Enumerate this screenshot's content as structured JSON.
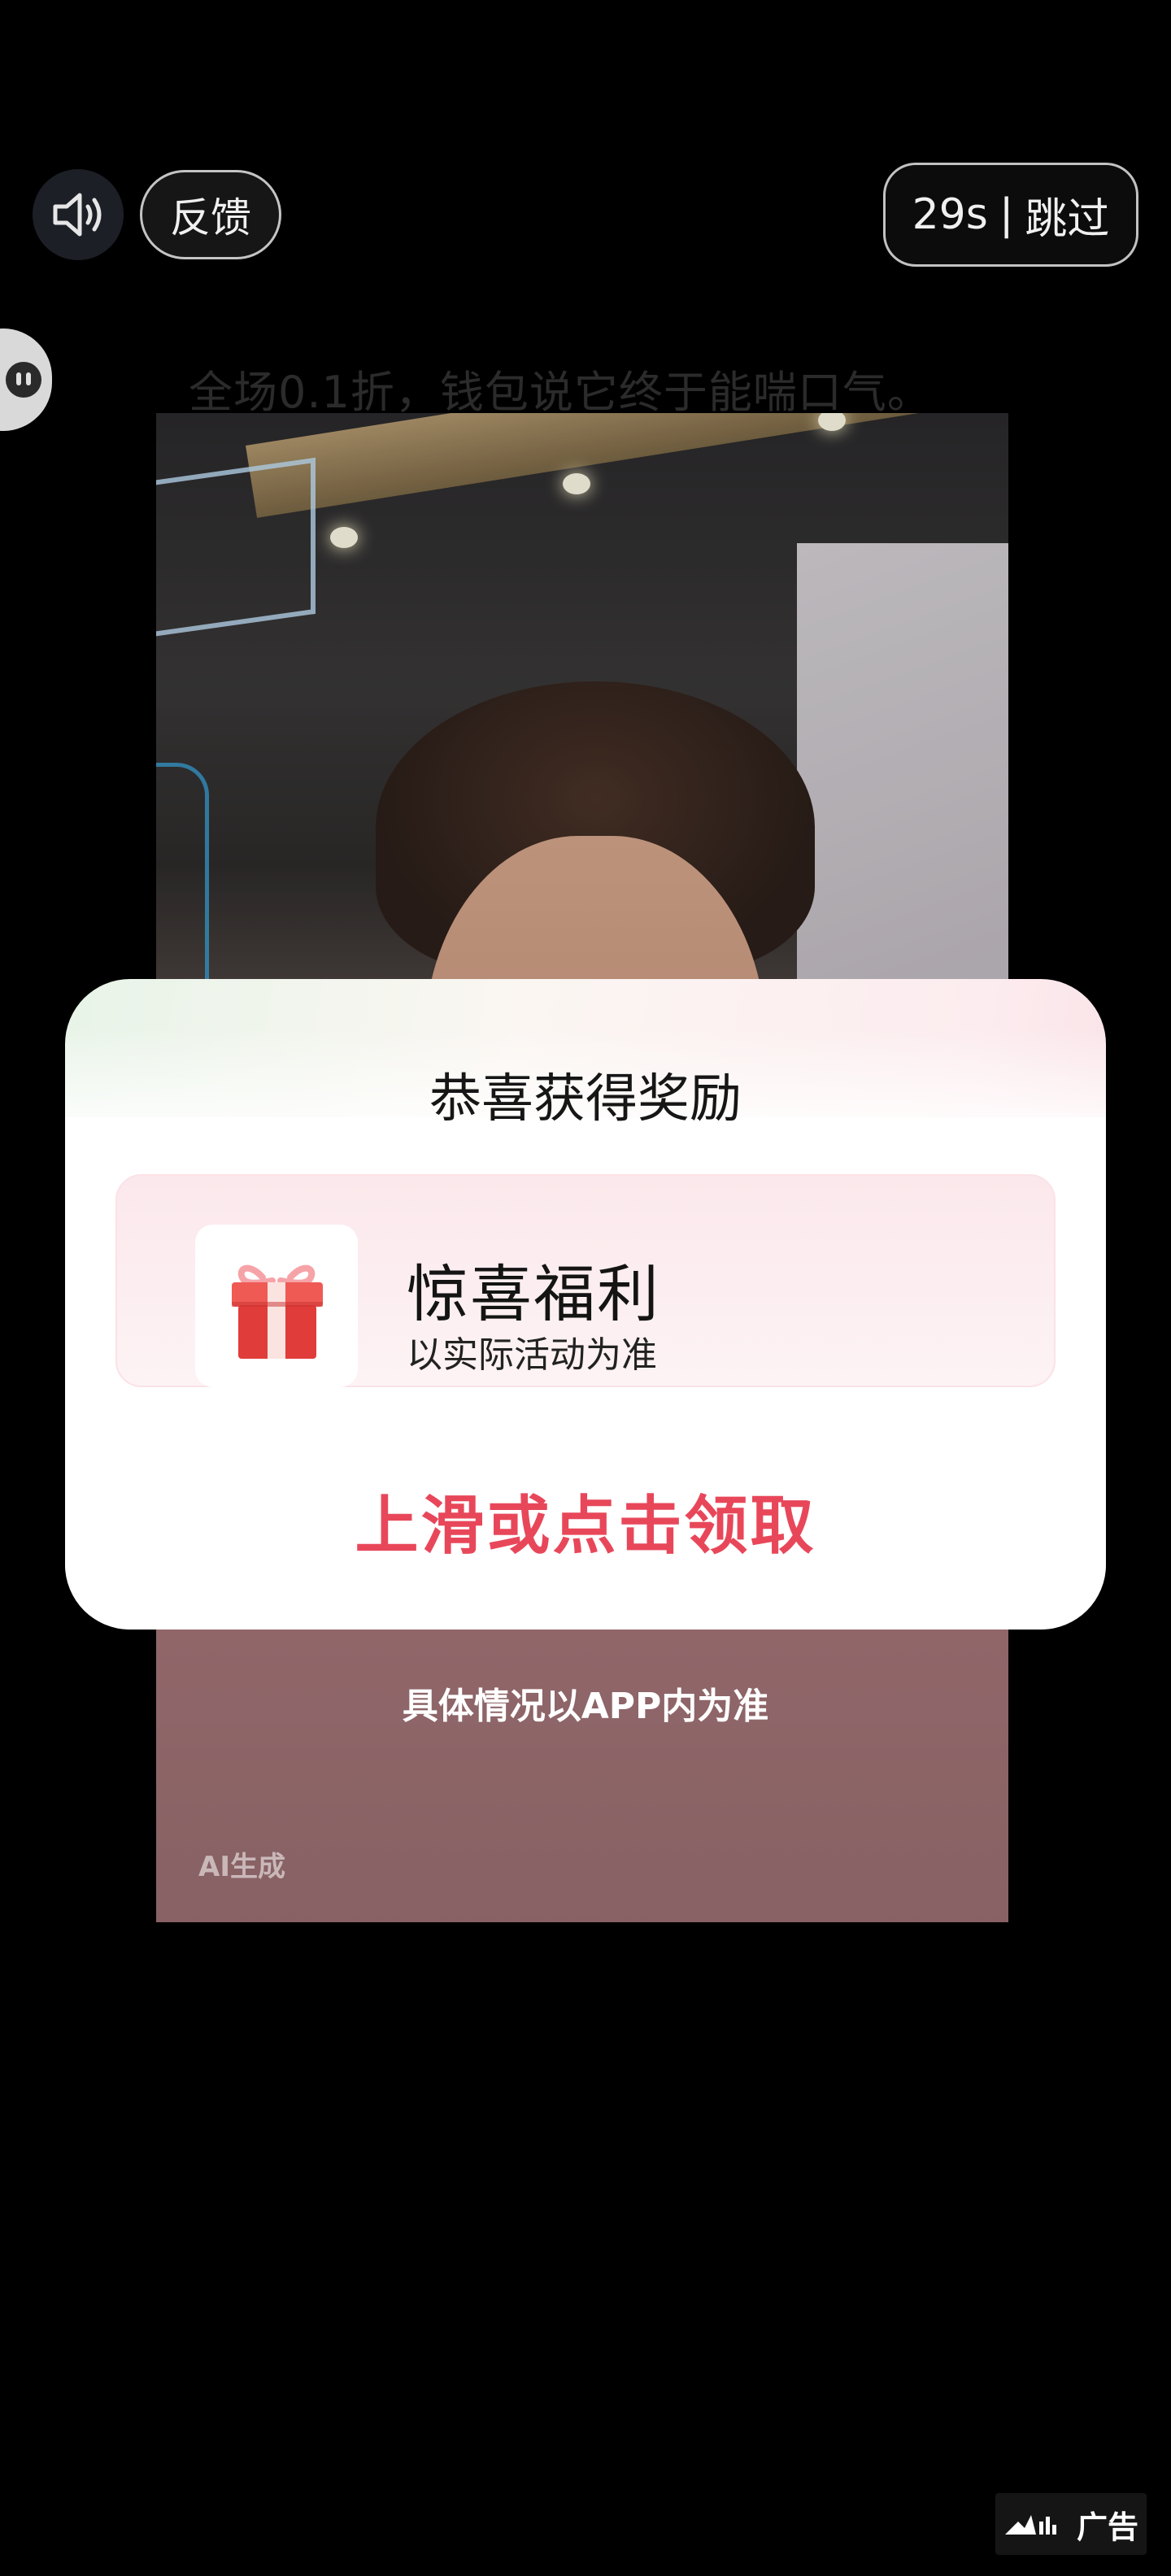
{
  "top_bar": {
    "sound_icon": "speaker-icon",
    "feedback_label": "反馈",
    "countdown": "29s",
    "separator": "|",
    "skip_label": "跳过"
  },
  "side_tab_icon": "chat-bubble-icon",
  "caption": "全场0.1折，钱包说它终于能喘口气。",
  "video": {
    "ai_label": "AI生成"
  },
  "reward_card": {
    "title": "恭喜获得奖励",
    "prize_icon": "gift-box-icon",
    "prize_name": "惊喜福利",
    "prize_sub": "以实际活动为准",
    "claim_text": "上滑或点击领取"
  },
  "disclaimer": "具体情况以APP内为准",
  "ad_badge": {
    "icon": "ad-logo-icon",
    "label": "广告"
  },
  "colors": {
    "claim_red": "#e8475a",
    "background": "#000000"
  }
}
